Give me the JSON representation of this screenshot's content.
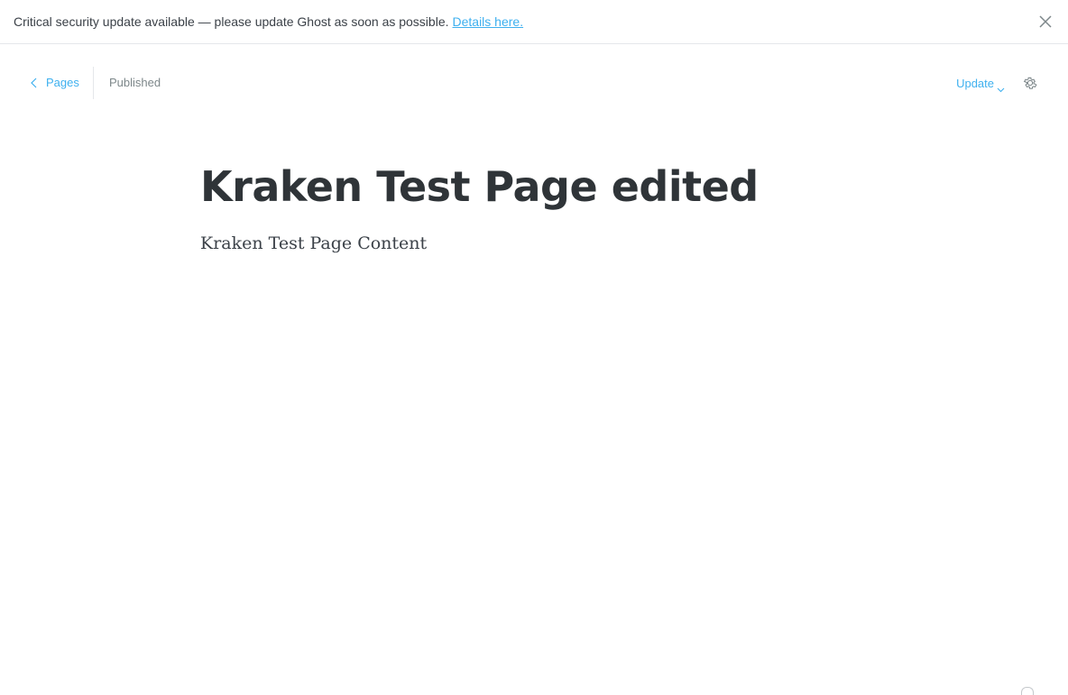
{
  "banner": {
    "message": "Critical security update available — please update Ghost as soon as possible.",
    "link_text": "Details here.",
    "close_icon": "close-icon"
  },
  "header": {
    "back_label": "Pages",
    "status": "Published",
    "update_label": "Update",
    "settings_icon": "gear-icon"
  },
  "editor": {
    "title": "Kraken Test Page edited",
    "content": "Kraken Test Page Content"
  },
  "colors": {
    "accent": "#3eb0ef",
    "text": "#3b4148",
    "muted": "#7d878a",
    "border": "#e5e7ea"
  }
}
